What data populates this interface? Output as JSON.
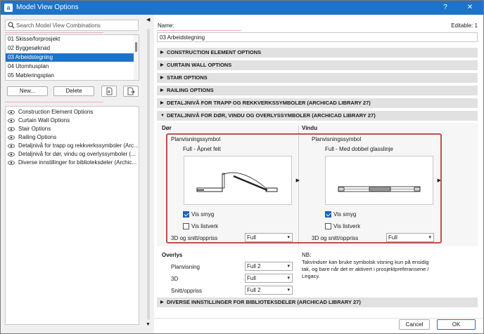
{
  "window": {
    "title": "Model View Options",
    "help_label": "?",
    "close_label": "✕"
  },
  "left": {
    "search_placeholder": "Search Model View Combinations",
    "combinations": [
      {
        "label": "01 Skisse/forprosjekt",
        "selected": false
      },
      {
        "label": "02 Byggesøknad",
        "selected": false
      },
      {
        "label": "03 Arbeidstegning",
        "selected": true
      },
      {
        "label": "04 Utomhusplan",
        "selected": false
      },
      {
        "label": "05 Møbleringsplan",
        "selected": false
      }
    ],
    "new_button": "New...",
    "delete_button": "Delete",
    "option_sets": [
      "Construction Element Options",
      "Curtain Wall Options",
      "Stair Options",
      "Railing Options",
      "Detaljnivå for trapp og rekkverkssymboler (Arc...",
      "Detaljnivå for dør, vindu og overlyssymboler (...",
      "Diverse innstillinger for biblioteksdeler (Archic..."
    ]
  },
  "right": {
    "name_label": "Name:",
    "editable_label": "Editable: 1",
    "name_value": "03 Arbeidstegning",
    "sections": [
      {
        "label": "CONSTRUCTION ELEMENT OPTIONS",
        "expanded": false
      },
      {
        "label": "CURTAIN WALL OPTIONS",
        "expanded": false
      },
      {
        "label": "STAIR OPTIONS",
        "expanded": false
      },
      {
        "label": "RAILING OPTIONS",
        "expanded": false
      },
      {
        "label": "DETALJNIVÅ FOR TRAPP OG REKKVERKSSYMBOLER (ARCHICAD LIBRARY 27)",
        "expanded": false
      },
      {
        "label": "DETALJNIVÅ FOR DØR, VINDU OG OVERLYSSYMBOLER (ARCHICAD LIBRARY 27)",
        "expanded": true
      }
    ],
    "door": {
      "title": "Dør",
      "plan_symbol_label": "Planvisningssymbol",
      "plan_symbol_value": "Full - Åpnet felt",
      "vis_smyg_label": "Vis smyg",
      "vis_smyg_checked": true,
      "vis_listverk_label": "Vis listverk",
      "vis_listverk_checked": false,
      "section_label": "3D og snitt/oppriss",
      "section_value": "Full"
    },
    "window_opts": {
      "title": "Vindu",
      "plan_symbol_label": "Planvisningssymbol",
      "plan_symbol_value": "Full - Med dobbel glasslinje",
      "vis_smyg_label": "Vis smyg",
      "vis_smyg_checked": true,
      "vis_listverk_label": "Vis listverk",
      "vis_listverk_checked": false,
      "section_label": "3D og snitt/oppriss",
      "section_value": "Full"
    },
    "overlys": {
      "title": "Overlys",
      "rows": [
        {
          "label": "Planvisning",
          "value": "Full 2"
        },
        {
          "label": "3D",
          "value": "Full"
        },
        {
          "label": "Snitt/oppriss",
          "value": "Full 2"
        }
      ]
    },
    "nb": {
      "label": "NB:",
      "text": "Takvinduer kan bruke symbolsk visning kun på ensidig tak, og bare når det er aktivert i prosjektpreferansene / Legacy."
    },
    "last_section": "DIVERSE INNSTILLINGER FOR BIBLIOTEKSDELER (ARCHICAD LIBRARY 27)"
  },
  "footer": {
    "cancel": "Cancel",
    "ok": "OK"
  },
  "colors": {
    "titlebar": "#1e73c8",
    "selection": "#1e73c8",
    "highlight_box": "#c0504d"
  }
}
